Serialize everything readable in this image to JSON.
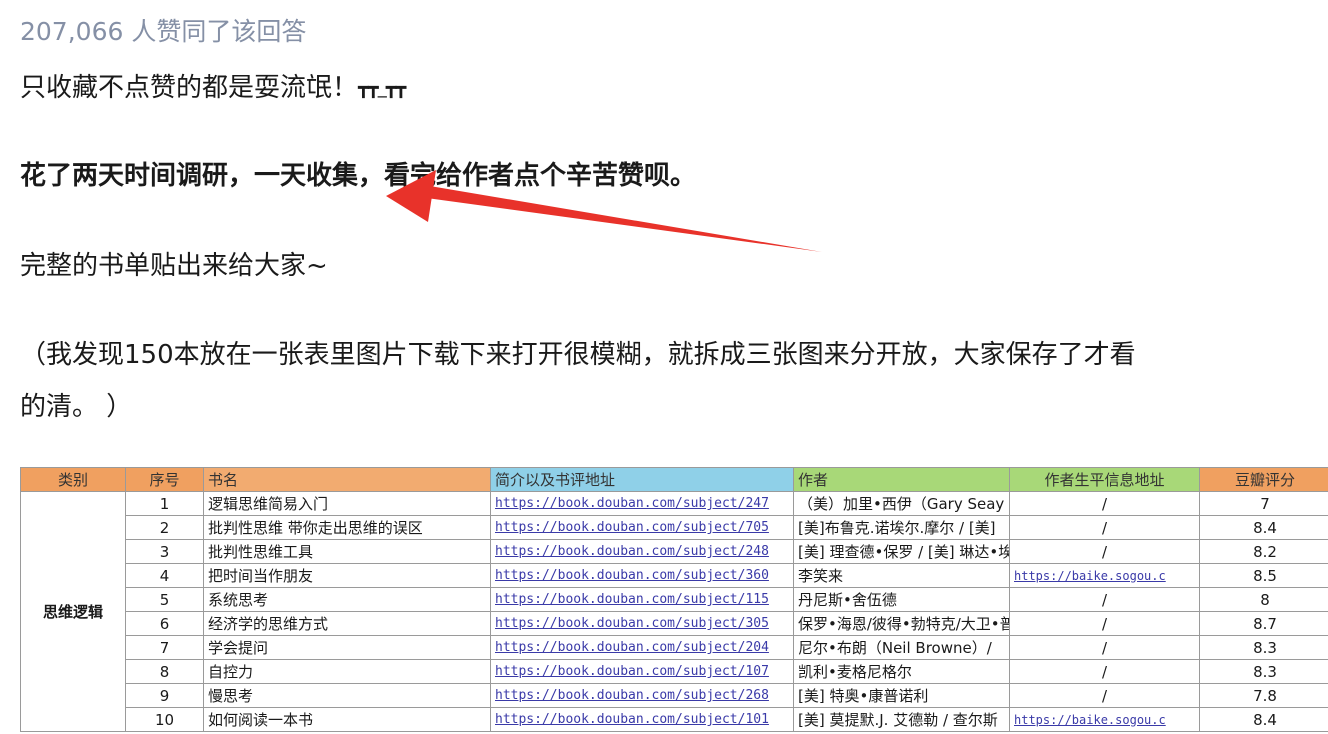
{
  "answer": {
    "likes_text": "207,066 人赞同了该回答",
    "line1": "只收藏不点赞的都是耍流氓！",
    "line1_emote": "┳┳_┳┳",
    "line2": "花了两天时间调研，一天收集，看完给作者点个辛苦赞呗。",
    "line3": "完整的书单贴出来给大家~",
    "line4": "（我发现150本放在一张表里图片下载下来打开很模糊，就拆成三张图来分开放，大家保存了才看",
    "line5": "的清。 ）"
  },
  "colors": {
    "arrow": "#e8322a",
    "likes": "#8590a6",
    "header_orange": "#f0a060",
    "header_blue": "#8fd0e8",
    "header_green": "#a8d878",
    "link": "#3a3aa8"
  },
  "sheet": {
    "headers": {
      "category": "类别",
      "index": "序号",
      "title": "书名",
      "link": "简介以及书评地址",
      "author": "作者",
      "bio": "作者生平信息地址",
      "score": "豆瓣评分"
    },
    "category_name": "思维逻辑",
    "rows": [
      {
        "no": "1",
        "title": "逻辑思维简易入门",
        "link": "https://book.douban.com/subject/247",
        "author": "（美）加里•西伊（Gary Seay",
        "bio": "/",
        "score": "7"
      },
      {
        "no": "2",
        "title": "批判性思维 带你走出思维的误区",
        "link": "https://book.douban.com/subject/705",
        "author": "[美]布鲁克.诺埃尔.摩尔 / [美]",
        "bio": "/",
        "score": "8.4"
      },
      {
        "no": "3",
        "title": "批判性思维工具",
        "link": "https://book.douban.com/subject/248",
        "author": "[美] 理查德•保罗 / [美] 琳达•埃",
        "bio": "/",
        "score": "8.2"
      },
      {
        "no": "4",
        "title": "把时间当作朋友",
        "link": "https://book.douban.com/subject/360",
        "author": "李笑来",
        "bio": "https://baike.sogou.c",
        "score": "8.5"
      },
      {
        "no": "5",
        "title": "系统思考",
        "link": "https://book.douban.com/subject/115",
        "author": "丹尼斯•舍伍德",
        "bio": "/",
        "score": "8"
      },
      {
        "no": "6",
        "title": "经济学的思维方式",
        "link": "https://book.douban.com/subject/305",
        "author": "保罗•海恩/彼得•勃特克/大卫•普",
        "bio": "/",
        "score": "8.7"
      },
      {
        "no": "7",
        "title": "学会提问",
        "link": "https://book.douban.com/subject/204",
        "author": "尼尔•布朗（Neil Browne）/",
        "bio": "/",
        "score": "8.3"
      },
      {
        "no": "8",
        "title": "自控力",
        "link": "https://book.douban.com/subject/107",
        "author": "凯利•麦格尼格尔",
        "bio": "/",
        "score": "8.3"
      },
      {
        "no": "9",
        "title": "慢思考",
        "link": "https://book.douban.com/subject/268",
        "author": "[美] 特奥•康普诺利",
        "bio": "/",
        "score": "7.8"
      },
      {
        "no": "10",
        "title": "如何阅读一本书",
        "link": "https://book.douban.com/subject/101",
        "author": "[美] 莫提默.J. 艾德勒 / 查尔斯",
        "bio": "https://baike.sogou.c",
        "score": "8.4"
      }
    ]
  }
}
